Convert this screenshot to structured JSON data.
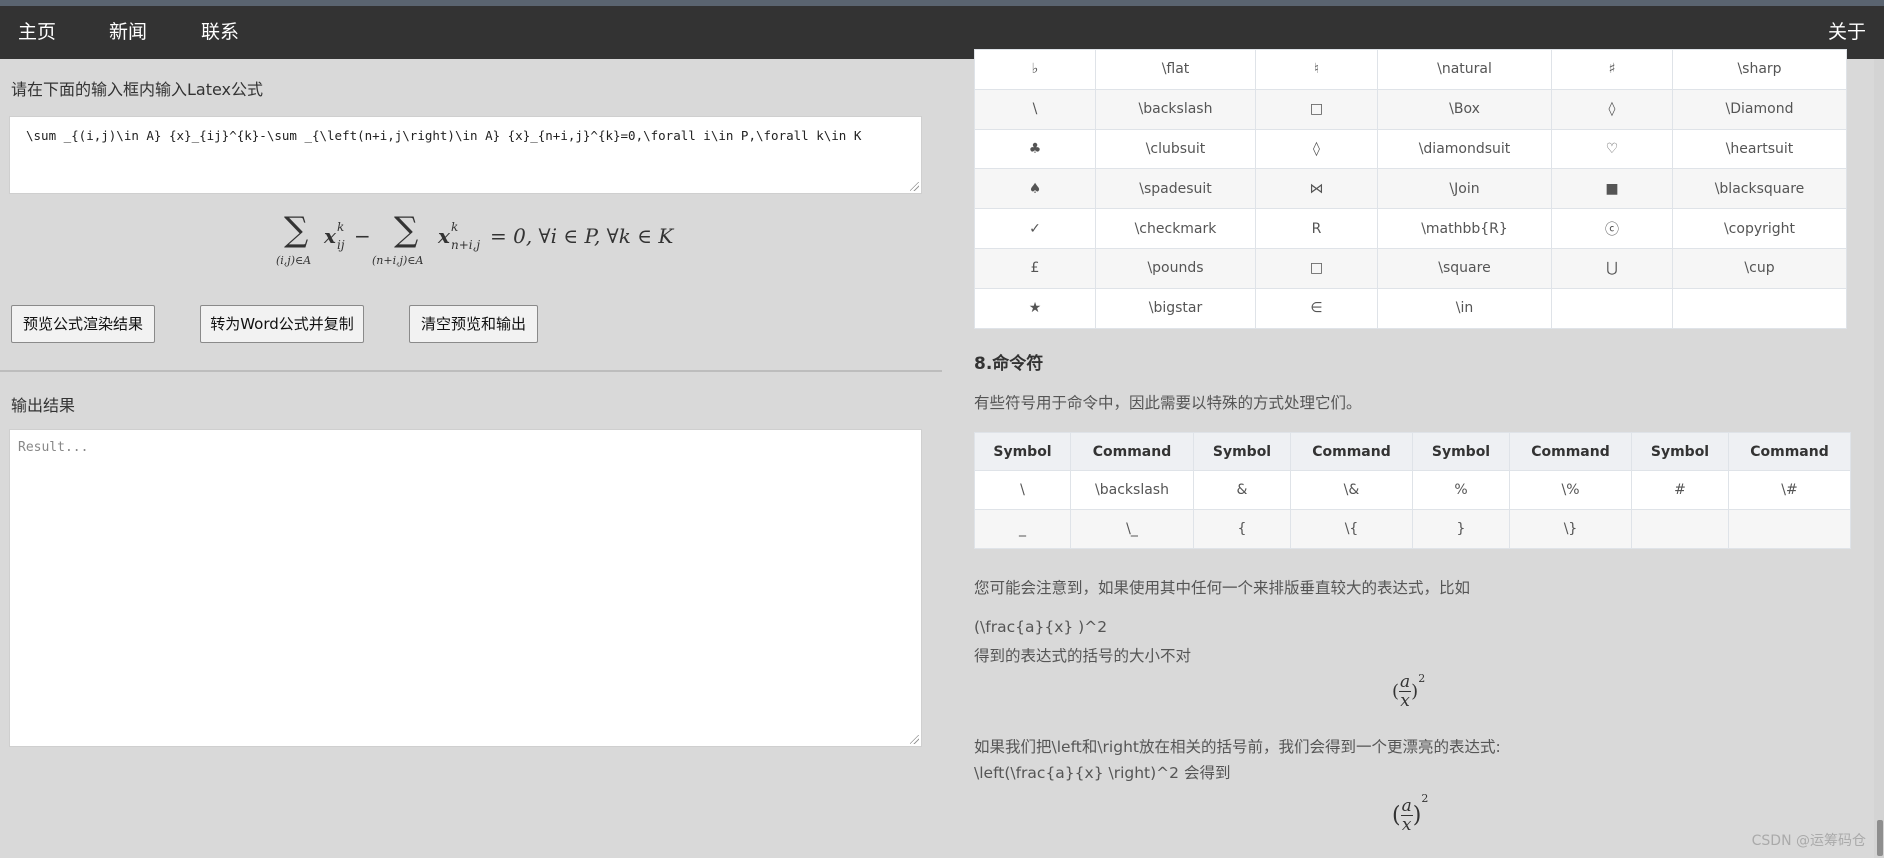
{
  "nav": {
    "home": "主页",
    "news": "新闻",
    "contact": "联系",
    "about": "关于"
  },
  "editor": {
    "prompt": "请在下面的输入框内输入Latex公式",
    "latex": "\\sum _{(i,j)\\in A} {x}_{ij}^{k}-\\sum _{\\left(n+i,j\\right)\\in A} {x}_{n+i,j}^{k}=0,\\forall i\\in P,\\forall k\\in K",
    "buttons": {
      "preview": "预览公式渲染结果",
      "word": "转为Word公式并复制",
      "clear": "清空预览和输出"
    },
    "output_label": "输出结果",
    "output_placeholder": "Result..."
  },
  "preview": {
    "sum": "∑",
    "sub1": "(i,j)∈A",
    "x": "x",
    "k": "k",
    "ij": "ij",
    "minus": "−",
    "sub2": "(n+i,j)∈A",
    "nij": "n+i,j",
    "tail": "= 0, ∀i ∈ P, ∀k ∈ K"
  },
  "symbol_table": {
    "rows": [
      [
        "♭",
        "\\flat",
        "♮",
        "\\natural",
        "♯",
        "\\sharp"
      ],
      [
        "\\",
        "\\backslash",
        "□",
        "\\Box",
        "◊",
        "\\Diamond"
      ],
      [
        "♣",
        "\\clubsuit",
        "◊",
        "\\diamondsuit",
        "♡",
        "\\heartsuit"
      ],
      [
        "♠",
        "\\spadesuit",
        "⋈",
        "\\Join",
        "■",
        "\\blacksquare"
      ],
      [
        "✓",
        "\\checkmark",
        "R",
        "\\mathbb{R}",
        "ⓒ",
        "\\copyright"
      ],
      [
        "£",
        "\\pounds",
        "□",
        "\\square",
        "⋃",
        "\\cup"
      ],
      [
        "★",
        "\\bigstar",
        "∈",
        "\\in",
        "",
        ""
      ]
    ]
  },
  "section8": {
    "title": "8.命令符",
    "desc": "有些符号用于命令中，因此需要以特殊的方式处理它们。",
    "headers": [
      "Symbol",
      "Command",
      "Symbol",
      "Command",
      "Symbol",
      "Command",
      "Symbol",
      "Command"
    ],
    "rows": [
      [
        "\\",
        "\\backslash",
        "&",
        "\\&",
        "%",
        "\\%",
        "#",
        "\\#"
      ],
      [
        "_",
        "\\_",
        "{",
        "\\{",
        "}",
        "\\}",
        "",
        ""
      ]
    ],
    "note": "您可能会注意到，如果使用其中任何一个来排版垂直较大的表达式，比如",
    "code1": "(\\frac{a}{x} )^2",
    "note2": "得到的表达式的括号的大小不对",
    "math1": {
      "lp": "(",
      "num": "a",
      "den": "x",
      "rp": ")",
      "exp": "2"
    },
    "note3": "如果我们把\\left和\\right放在相关的括号前，我们会得到一个更漂亮的表达式:",
    "code2": "\\left(\\frac{a}{x} \\right)^2 会得到",
    "math2": {
      "lp": "(",
      "num": "a",
      "den": "x",
      "rp": ")",
      "exp": "2"
    }
  },
  "watermark": "CSDN @运筹码仓"
}
